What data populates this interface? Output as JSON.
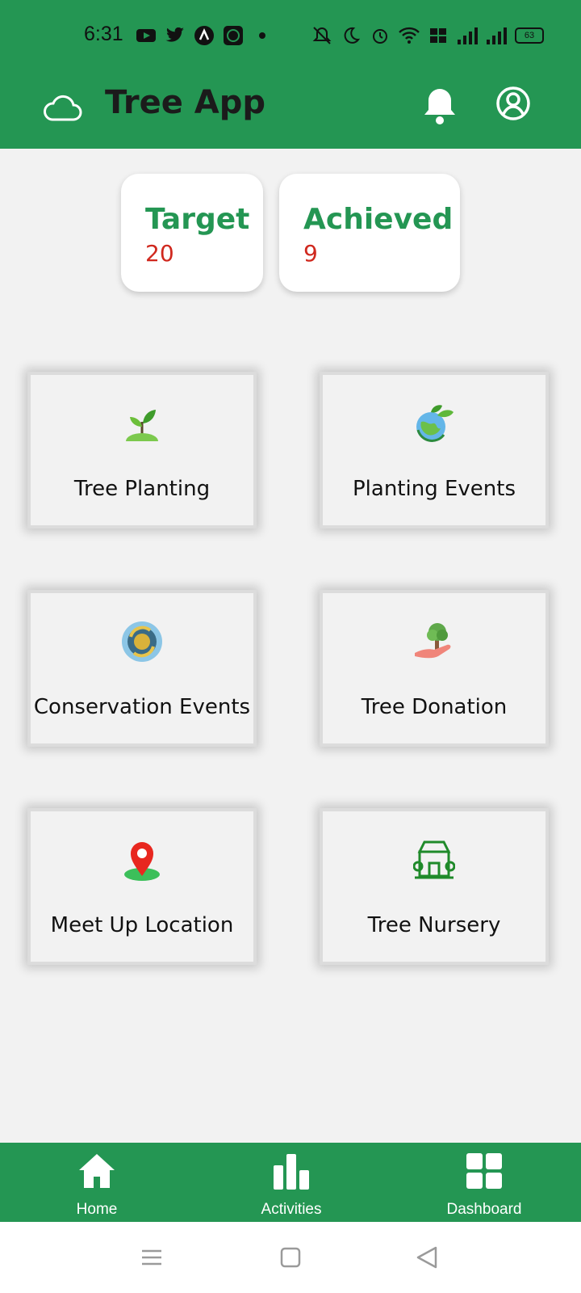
{
  "status_bar": {
    "time": "6:31",
    "battery": "63",
    "icons_left": [
      "youtube-icon",
      "twitter-icon",
      "arc-icon",
      "app-icon",
      "dot-icon"
    ],
    "icons_right": [
      "mute-icon",
      "moon-icon",
      "alarm-icon",
      "wifi-icon",
      "volte-icon",
      "signal-icon",
      "signal-icon"
    ]
  },
  "app_bar": {
    "title": "Tree App",
    "icons": [
      "cloud-icon",
      "bell-icon",
      "account-icon"
    ]
  },
  "stats": {
    "target_label": "Target",
    "target_value": "20",
    "achieved_label": "Achieved",
    "achieved_value": "9"
  },
  "tiles": [
    {
      "label": "Tree Planting",
      "icon": "sprout-icon"
    },
    {
      "label": "Planting Events",
      "icon": "globe-leaf-icon"
    },
    {
      "label": "Conservation Events",
      "icon": "recycle-earth-icon"
    },
    {
      "label": "Tree Donation",
      "icon": "hand-tree-icon"
    },
    {
      "label": "Meet Up Location",
      "icon": "location-pin-icon"
    },
    {
      "label": "Tree Nursery",
      "icon": "nursery-store-icon"
    }
  ],
  "bottom_nav": [
    {
      "label": "Home",
      "icon": "home-icon"
    },
    {
      "label": "Activities",
      "icon": "bar-chart-icon"
    },
    {
      "label": "Dashboard",
      "icon": "grid-icon"
    }
  ],
  "colors": {
    "primary": "#249653",
    "accent_red": "#d0281e",
    "background": "#f2f2f2"
  }
}
